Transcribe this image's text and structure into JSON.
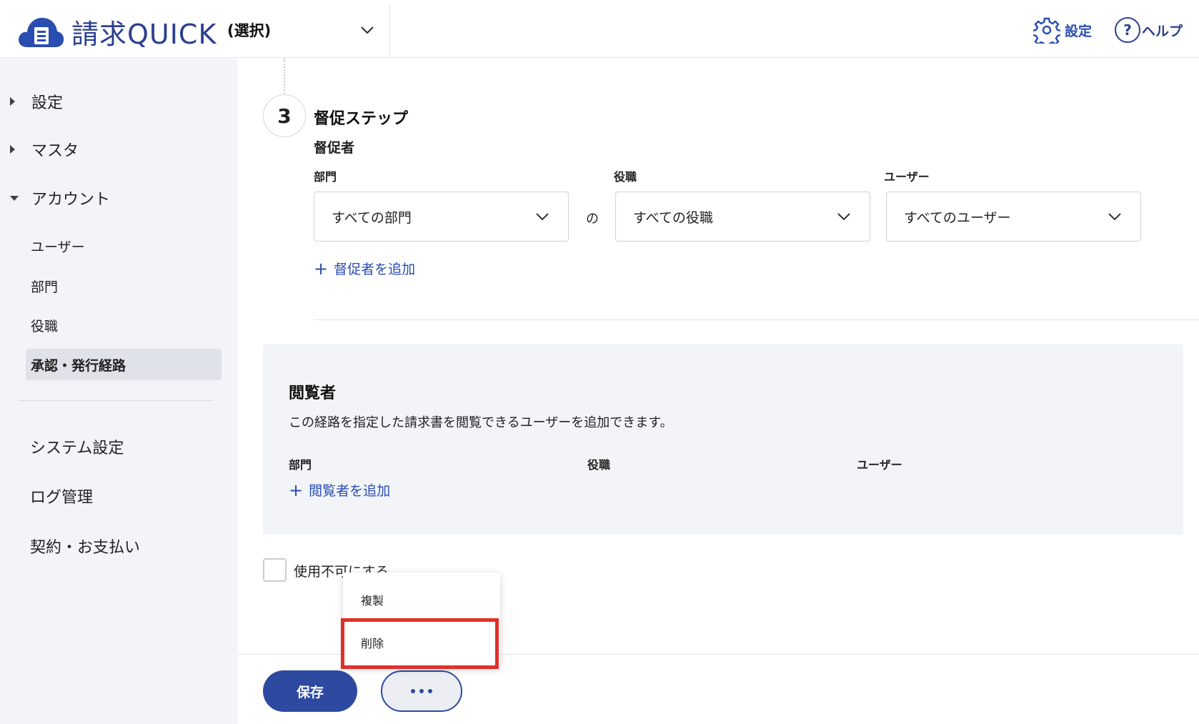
{
  "header": {
    "brand": "請求QUICK",
    "company_select": "(選択)",
    "settings_label": "設定",
    "help_label": "ヘルプ",
    "help_icon_glyph": "?"
  },
  "sidebar": {
    "items": [
      {
        "label": "設定",
        "state": "collapsed"
      },
      {
        "label": "マスタ",
        "state": "collapsed"
      },
      {
        "label": "アカウント",
        "state": "expanded"
      }
    ],
    "account_sub": [
      {
        "label": "ユーザー"
      },
      {
        "label": "部門"
      },
      {
        "label": "役職"
      },
      {
        "label": "承認・発行経路",
        "active": true
      }
    ],
    "bottom_items": [
      {
        "label": "システム設定"
      },
      {
        "label": "ログ管理"
      },
      {
        "label": "契約・お支払い"
      }
    ]
  },
  "step": {
    "number": "3",
    "title": "督促ステップ",
    "reminder_label": "督促者",
    "department_label": "部門",
    "position_label": "役職",
    "user_label": "ユーザー",
    "department_value": "すべての部門",
    "of_label": "の",
    "position_value": "すべての役職",
    "user_value": "すべてのユーザー",
    "add_reminder": "督促者を追加"
  },
  "viewers": {
    "title": "閲覧者",
    "description": "この経路を指定した請求書を閲覧できるユーザーを追加できます。",
    "col_department": "部門",
    "col_position": "役職",
    "col_user": "ユーザー",
    "add_viewer": "閲覧者を追加"
  },
  "disable_label": "使用不可にする",
  "actions": {
    "save": "保存",
    "menu": [
      {
        "label": "複製"
      },
      {
        "label": "削除",
        "highlighted": true
      }
    ]
  },
  "colors": {
    "brand": "#2a3f8f",
    "accent": "#2d4aa0",
    "highlight": "#e0302a",
    "sidebar_bg": "#f2f4f8"
  }
}
